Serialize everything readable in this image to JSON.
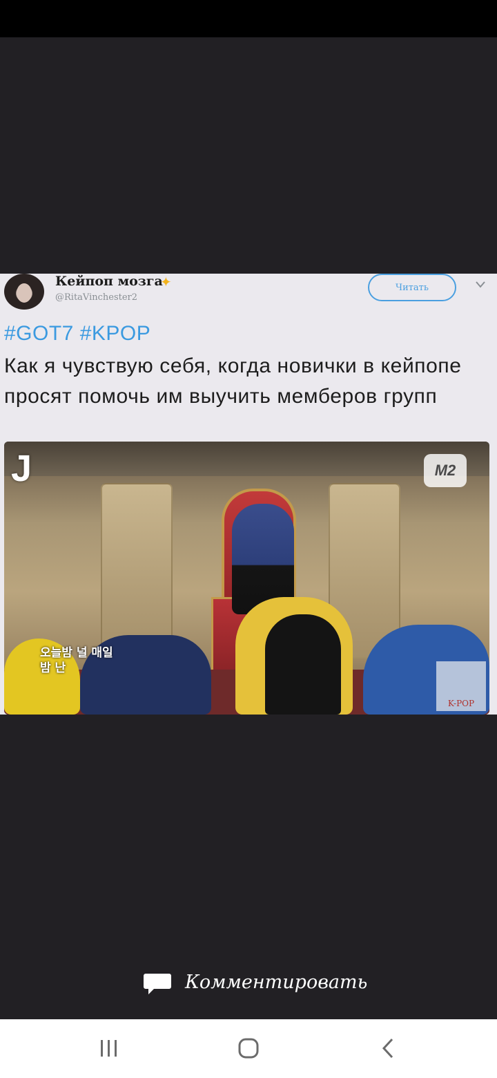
{
  "tweet": {
    "account_name": "Кейпоп мозга",
    "account_handle": "@RitaVinchester2",
    "follow_label": "Читать",
    "hashtags": "#GOT7 #KPOP",
    "text": "Как я чувствую себя, когда новички в кейпопе просят помочь им выучить мемберов групп",
    "photo": {
      "caption": "오늘밤 널 매일밤 난",
      "show_logo": "J",
      "channel_logo": "M2",
      "badge_text": "K-POP"
    }
  },
  "comment": {
    "label": "Комментировать",
    "icon": "speech-bubble-icon"
  },
  "nav": {
    "recent_icon": "recent-apps-icon",
    "home_icon": "home-icon",
    "back_icon": "back-icon"
  },
  "colors": {
    "viewer_background": "#222024",
    "hashtag": "#3b9ae0",
    "nav_background": "#ffffff"
  }
}
